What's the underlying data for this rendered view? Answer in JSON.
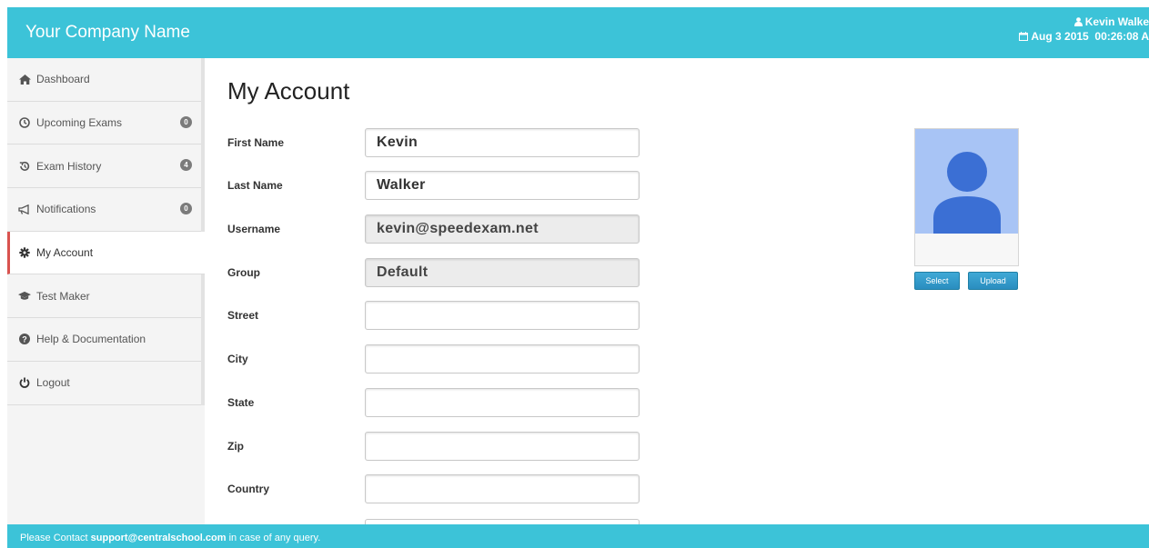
{
  "header": {
    "brand": "Your Company Name",
    "user_name": "Kevin Walke",
    "date": "Aug 3 2015",
    "time": "00:26:08 A"
  },
  "sidebar": {
    "items": [
      {
        "label": "Dashboard",
        "icon": "home-icon",
        "badge": null
      },
      {
        "label": "Upcoming Exams",
        "icon": "clock-icon",
        "badge": "0"
      },
      {
        "label": "Exam History",
        "icon": "history-icon",
        "badge": "4"
      },
      {
        "label": "Notifications",
        "icon": "megaphone-icon",
        "badge": "0"
      },
      {
        "label": "My Account",
        "icon": "gear-icon",
        "badge": null
      },
      {
        "label": "Test Maker",
        "icon": "graduation-cap-icon",
        "badge": null
      },
      {
        "label": "Help & Documentation",
        "icon": "question-circle-icon",
        "badge": null
      },
      {
        "label": "Logout",
        "icon": "power-icon",
        "badge": null
      }
    ]
  },
  "main": {
    "title": "My Account",
    "fields": {
      "first_name": {
        "label": "First Name",
        "value": "Kevin"
      },
      "last_name": {
        "label": "Last Name",
        "value": "Walker"
      },
      "username": {
        "label": "Username",
        "value": "kevin@speedexam.net"
      },
      "group": {
        "label": "Group",
        "value": "Default"
      },
      "street": {
        "label": "Street",
        "value": ""
      },
      "city": {
        "label": "City",
        "value": ""
      },
      "state": {
        "label": "State",
        "value": ""
      },
      "zip": {
        "label": "Zip",
        "value": ""
      },
      "country": {
        "label": "Country",
        "value": ""
      }
    }
  },
  "photo": {
    "select_label": "Select",
    "upload_label": "Upload"
  },
  "footer": {
    "prefix": "Please Contact ",
    "email": "support@centralschool.com",
    "suffix": " in case of any query."
  },
  "colors": {
    "brand": "#3cc3d8",
    "active_marker": "#d9534f",
    "avatar_bg": "#a8c4f5",
    "avatar_figure": "#3b6fd4",
    "button": "#2a8dbf"
  }
}
